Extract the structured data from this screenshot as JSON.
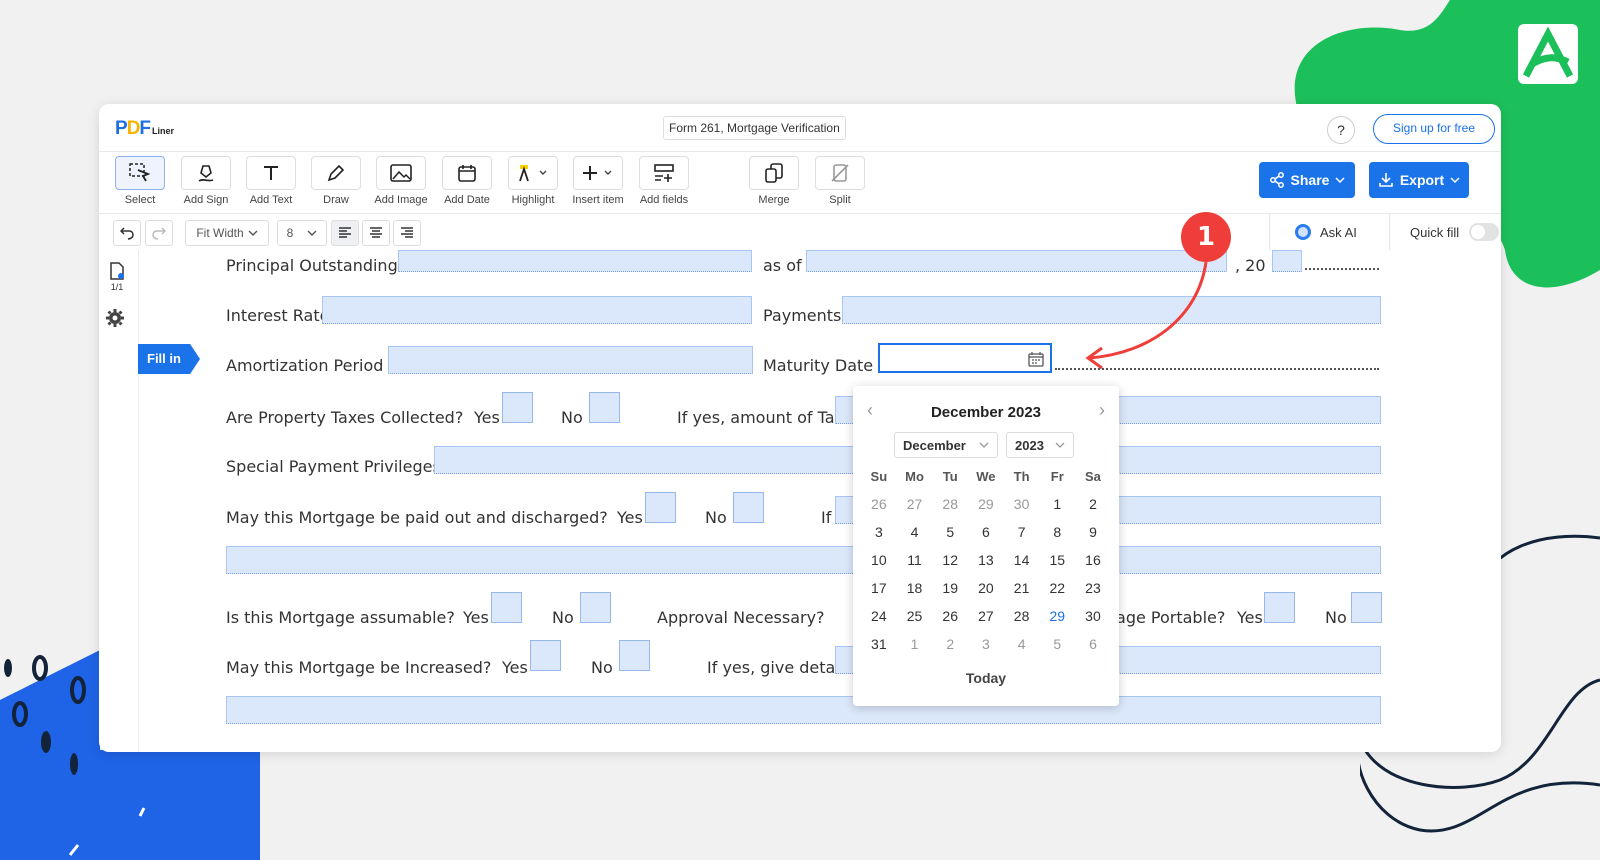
{
  "app": {
    "logo": {
      "p": "P",
      "d": "D",
      "f": "F",
      "suffix": "Liner"
    },
    "document_title": "Form 261, Mortgage Verification",
    "help_label": "?",
    "signup_label": "Sign up for free"
  },
  "toolbar": {
    "tools": [
      {
        "label": "Select",
        "icon": "select-icon"
      },
      {
        "label": "Add Sign",
        "icon": "sign-pen-icon"
      },
      {
        "label": "Add Text",
        "icon": "text-icon"
      },
      {
        "label": "Draw",
        "icon": "pen-icon"
      },
      {
        "label": "Add Image",
        "icon": "image-icon"
      },
      {
        "label": "Add Date",
        "icon": "calendar-icon"
      },
      {
        "label": "Highlight",
        "icon": "highlighter-icon"
      },
      {
        "label": "Insert item",
        "icon": "plus-icon"
      },
      {
        "label": "Add fields",
        "icon": "fields-icon"
      },
      {
        "label": "Merge",
        "icon": "merge-icon"
      },
      {
        "label": "Split",
        "icon": "split-icon"
      }
    ],
    "share_label": "Share",
    "export_label": "Export"
  },
  "subbar": {
    "zoom": "Fit Width",
    "font_size": "8",
    "ask_ai": "Ask AI",
    "quick_fill": "Quick fill"
  },
  "sidebar": {
    "page_count": "1/1",
    "fill_in": "Fill in"
  },
  "form": {
    "principal": "Principal Outstanding",
    "as_of": "as of",
    "year_prefix": ", 20",
    "interest_rate": "Interest Rate",
    "payments": "Payments",
    "amortization": "Amortization Period",
    "maturity": "Maturity Date",
    "taxes_q": "Are Property Taxes Collected?",
    "yes": "Yes",
    "no": "No",
    "tax_amount": "If yes, amount of Tax",
    "special": "Special Payment Privileges",
    "discharge_q": "May this Mortgage be paid out and discharged?",
    "if_fragment": "If",
    "assumable_q": "Is this Mortgage assumable?",
    "approval": "Approval Necessary?",
    "portable": "rtgage Portable?",
    "increased_q": "May this Mortgage be Increased?",
    "give_details": "If yes, give detail"
  },
  "annotation": {
    "step_number": "1",
    "color": "#ef3e3a"
  },
  "calendar": {
    "header": "December 2023",
    "month_select": "December",
    "year_select": "2023",
    "day_names": [
      "Su",
      "Mo",
      "Tu",
      "We",
      "Th",
      "Fr",
      "Sa"
    ],
    "weeks": [
      [
        "26",
        "27",
        "28",
        "29",
        "30",
        "1",
        "2"
      ],
      [
        "3",
        "4",
        "5",
        "6",
        "7",
        "8",
        "9"
      ],
      [
        "10",
        "11",
        "12",
        "13",
        "14",
        "15",
        "16"
      ],
      [
        "17",
        "18",
        "19",
        "20",
        "21",
        "22",
        "23"
      ],
      [
        "24",
        "25",
        "26",
        "27",
        "28",
        "29",
        "30"
      ],
      [
        "31",
        "1",
        "2",
        "3",
        "4",
        "5",
        "6"
      ]
    ],
    "today_label": "Today"
  },
  "colors": {
    "accent": "#1a73e8",
    "field_fill": "#dbe8fb",
    "green_deco": "#1cc05a",
    "blue_deco": "#1f63e6"
  }
}
